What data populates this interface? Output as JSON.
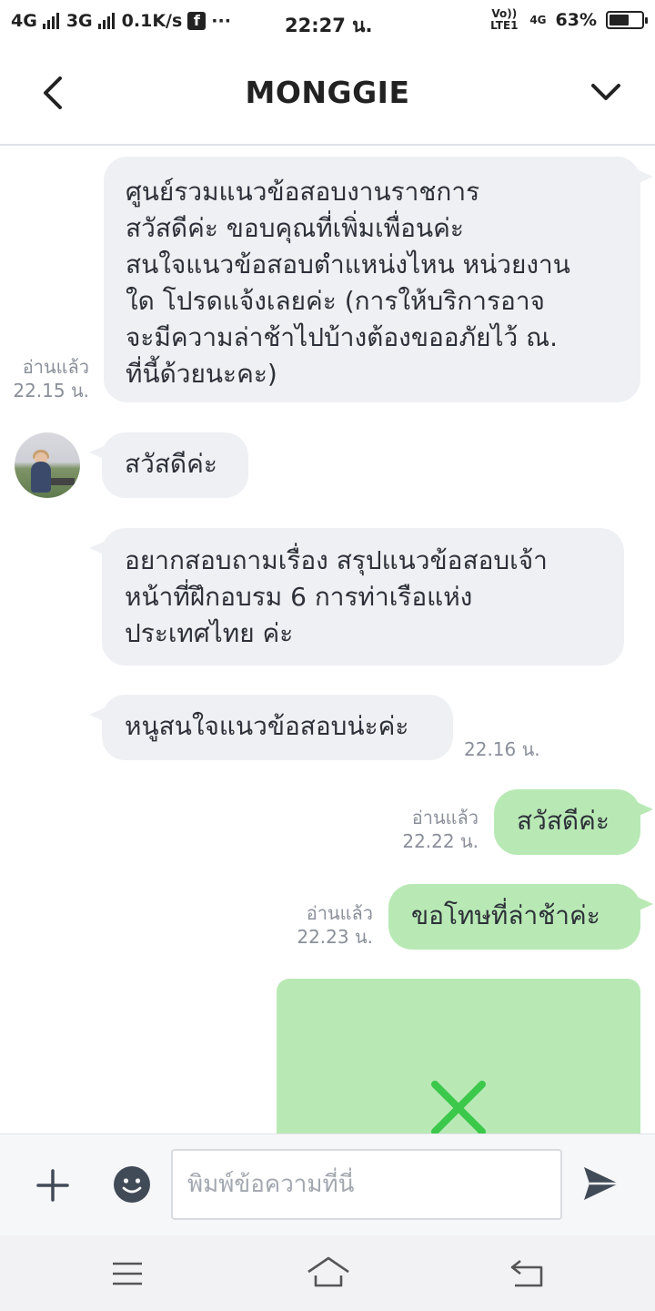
{
  "status_bar": {
    "network1": "4G",
    "network2": "3G",
    "speed": "0.1K/s",
    "facebook_icon": "f",
    "more": "···",
    "time": "22:27 น.",
    "volte": "Vo))\nLTE1",
    "network3": "4G",
    "battery_percent": "63%",
    "battery_level": 0.63
  },
  "header": {
    "title": "MONGGIE",
    "back_icon": "chevron-left-icon",
    "menu_icon": "chevron-down-icon"
  },
  "messages": [
    {
      "direction": "incoming",
      "text": "ศูนย์รวมแนวข้อสอบงานราชการ\nสวัสดีค่ะ  ขอบคุณที่เพิ่มเพื่อนค่ะ\nสนใจแนวข้อสอบตำแหน่งไหน หน่วยงาน\nใด โปรดแจ้งเลยค่ะ   (การให้บริการอาจ\nจะมีความล่าช้าไปบ้างต้องขออภัยไว้ ณ.\nที่นี้ด้วยนะคะ)",
      "read": "อ่านแล้ว",
      "time": "22.15 น."
    },
    {
      "direction": "incoming",
      "text": "สวัสดีค่ะ"
    },
    {
      "direction": "incoming",
      "text": "อยากสอบถามเรื่อง สรุปแนวข้อสอบเจ้า\nหน้าที่ฝึกอบรม 6 การท่าเรือแห่ง\nประเทศไทย ค่ะ"
    },
    {
      "direction": "incoming",
      "text": "หนูสนใจแนวข้อสอบน่ะค่ะ",
      "time": "22.16 น."
    },
    {
      "direction": "outgoing",
      "text": "สวัสดีค่ะ",
      "read": "อ่านแล้ว",
      "time": "22.22 น."
    },
    {
      "direction": "outgoing",
      "text": "ขอโทษที่ล่าช้าค่ะ",
      "read": "อ่านแล้ว",
      "time": "22.23 น."
    },
    {
      "direction": "outgoing",
      "type": "image-failed",
      "icon": "x-mark-icon"
    }
  ],
  "input": {
    "placeholder": "พิมพ์ข้อความที่นี่",
    "plus_icon": "plus-icon",
    "emoji_icon": "smiley-icon",
    "send_icon": "send-icon"
  },
  "nav": {
    "menu_icon": "menu-icon",
    "home_icon": "home-icon",
    "back_icon": "back-icon"
  },
  "colors": {
    "incoming_bubble": "#eef0f3",
    "outgoing_bubble": "#b8e9b5",
    "x_mark": "#3cc84a"
  }
}
